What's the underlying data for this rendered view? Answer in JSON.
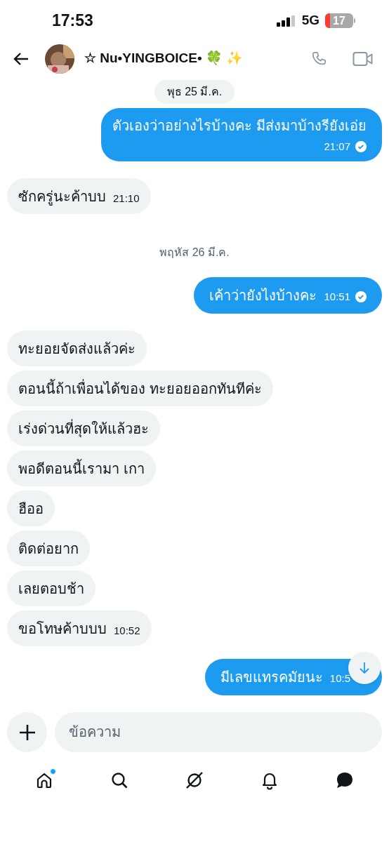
{
  "status_bar": {
    "time": "17:53",
    "network": "5G",
    "battery": "17"
  },
  "header": {
    "name": "☆ Nu•YINGBOICE• 🍀 ✨"
  },
  "messages": [
    {
      "kind": "date",
      "text": "พุธ 25 มี.ค.",
      "highlighted": true
    },
    {
      "kind": "outgoing",
      "text": "ตัวเองว่าอย่างไรบ้างคะ มีส่งมาบ้างรียังเอ่ย",
      "time": "21:07",
      "read": true
    },
    {
      "kind": "incoming",
      "text": "ซักครู่นะค้าบบ",
      "time": "21:10"
    },
    {
      "kind": "date",
      "text": "พฤหัส 26 มี.ค.",
      "highlighted": false
    },
    {
      "kind": "outgoing",
      "text": "เค้าว่ายังไงบ้างคะ",
      "time": "10:51",
      "read": true
    },
    {
      "kind": "incoming",
      "text": "ทะยอยจัดส่งแล้วค่ะ"
    },
    {
      "kind": "incoming",
      "text": "ตอนนี้ถ้าเพื่อนได้ของ ทะยอยออกทันทีค่ะ"
    },
    {
      "kind": "incoming",
      "text": "เร่งด่วนที่สุดให้แล้วฮะ"
    },
    {
      "kind": "incoming",
      "text": "พอดีตอนนี้เรามา เกา"
    },
    {
      "kind": "incoming",
      "text": "ฮืออ"
    },
    {
      "kind": "incoming",
      "text": "ติดต่อยาก"
    },
    {
      "kind": "incoming",
      "text": "เลยตอบช้า"
    },
    {
      "kind": "incoming",
      "text": "ขอโทษค้าบบบ",
      "time": "10:52"
    },
    {
      "kind": "outgoing",
      "text": "มีเลขแทรคมัยนะ",
      "time": "10:5"
    }
  ],
  "composer": {
    "placeholder": "ข้อความ"
  },
  "nav": [
    {
      "kind": "home",
      "badge": true
    },
    {
      "kind": "search",
      "badge": false
    },
    {
      "kind": "grok",
      "badge": false
    },
    {
      "kind": "bell",
      "badge": false
    },
    {
      "kind": "messages",
      "badge": false
    }
  ]
}
